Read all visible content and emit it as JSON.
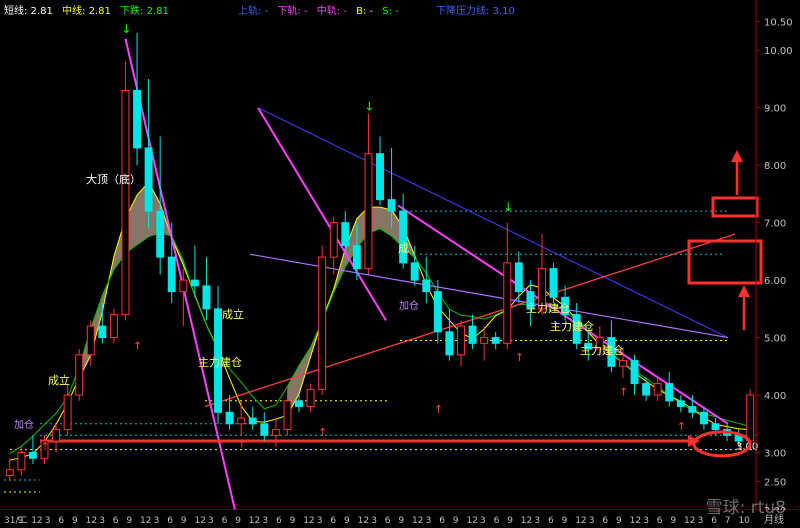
{
  "legend": {
    "short_label": "短线: 2.81",
    "mid_label": "中线: 2.81",
    "down_label": "下跌: 2.81",
    "upper_rail": "上轨: -",
    "down_rail": "下轨: -",
    "mid_rail": "中轨: -",
    "b_label": "B: -",
    "s_label": "S: -",
    "pressure_label": "下降压力线: 3.10"
  },
  "watermark": "雪球: rtu8",
  "period_label": "月线",
  "colors": {
    "up": "#ff3232",
    "down": "#00e5e5",
    "magenta": "#ff40ff",
    "blue": "#4040ff",
    "lavender": "#b070ff",
    "yellow": "#ffff00",
    "green": "#00ff00",
    "red": "#ff3030",
    "grid": "#7a0000",
    "text": "#c0c0c0"
  },
  "chart_data": {
    "type": "candlestick",
    "ylim": [
      2.0,
      10.7
    ],
    "y_ticks": [
      "10.50",
      "10.00",
      "9.00",
      "8.00",
      "7.00",
      "6.00",
      "5.00",
      "4.00",
      "3.00",
      "2.50",
      "2.00"
    ],
    "y_tick_values": [
      10.5,
      10.0,
      9.0,
      8.0,
      7.0,
      6.0,
      5.0,
      4.0,
      3.0,
      2.5,
      2.0
    ],
    "x_labels": [
      "31/二",
      "9",
      "12",
      "3",
      "6",
      "9",
      "12",
      "3",
      "6",
      "9",
      "12",
      "3",
      "6",
      "9",
      "12",
      "3",
      "6",
      "9",
      "12",
      "3",
      "6",
      "9",
      "12",
      "3",
      "6",
      "9",
      "12",
      "3",
      "6",
      "9",
      "12",
      "3",
      "6",
      "9",
      "12",
      "3",
      "6",
      "9",
      "12",
      "3",
      "6",
      "9",
      "12",
      "3",
      "6",
      "9",
      "12",
      "3",
      "6",
      "9",
      "12",
      "3",
      "6",
      "7",
      "10"
    ],
    "candles": [
      [
        2.6,
        2.9,
        2.5,
        2.7
      ],
      [
        2.7,
        3.1,
        2.6,
        3.0
      ],
      [
        3.0,
        3.3,
        2.8,
        2.9
      ],
      [
        2.9,
        3.3,
        2.8,
        3.2
      ],
      [
        3.2,
        3.5,
        3.0,
        3.4
      ],
      [
        3.4,
        4.2,
        3.3,
        4.0
      ],
      [
        4.0,
        4.8,
        3.9,
        4.7
      ],
      [
        4.7,
        5.3,
        4.5,
        5.2
      ],
      [
        5.2,
        5.6,
        4.9,
        5.0
      ],
      [
        5.0,
        5.5,
        4.9,
        5.4
      ],
      [
        5.4,
        9.8,
        5.3,
        9.3
      ],
      [
        9.3,
        10.3,
        8.0,
        8.3
      ],
      [
        8.3,
        9.5,
        6.9,
        7.2
      ],
      [
        7.2,
        8.5,
        6.1,
        6.4
      ],
      [
        6.4,
        7.0,
        5.6,
        5.8
      ],
      [
        5.8,
        6.2,
        5.2,
        6.0
      ],
      [
        6.0,
        6.6,
        5.7,
        5.9
      ],
      [
        5.9,
        6.4,
        5.3,
        5.5
      ],
      [
        5.5,
        5.9,
        3.5,
        3.7
      ],
      [
        3.7,
        4.0,
        3.4,
        3.5
      ],
      [
        3.5,
        3.9,
        3.3,
        3.6
      ],
      [
        3.6,
        3.8,
        3.4,
        3.5
      ],
      [
        3.5,
        3.7,
        3.2,
        3.3
      ],
      [
        3.3,
        3.6,
        3.1,
        3.4
      ],
      [
        3.4,
        4.0,
        3.3,
        3.9
      ],
      [
        3.9,
        4.0,
        3.7,
        3.8
      ],
      [
        3.8,
        4.2,
        3.7,
        4.1
      ],
      [
        4.1,
        6.6,
        4.0,
        6.4
      ],
      [
        6.4,
        7.1,
        6.1,
        7.0
      ],
      [
        7.0,
        7.2,
        6.5,
        6.6
      ],
      [
        6.6,
        7.0,
        6.0,
        6.2
      ],
      [
        6.2,
        8.9,
        6.1,
        8.2
      ],
      [
        8.2,
        8.5,
        7.3,
        7.4
      ],
      [
        7.4,
        8.3,
        6.9,
        7.2
      ],
      [
        7.2,
        7.5,
        6.2,
        6.3
      ],
      [
        6.3,
        6.6,
        5.9,
        6.0
      ],
      [
        6.0,
        6.4,
        5.6,
        5.8
      ],
      [
        5.8,
        6.0,
        4.9,
        5.1
      ],
      [
        5.1,
        5.5,
        4.6,
        4.7
      ],
      [
        4.7,
        5.3,
        4.5,
        5.2
      ],
      [
        5.2,
        5.4,
        4.8,
        4.9
      ],
      [
        4.9,
        5.2,
        4.6,
        5.0
      ],
      [
        5.0,
        5.1,
        4.8,
        4.9
      ],
      [
        4.9,
        7.0,
        4.8,
        6.3
      ],
      [
        6.3,
        6.5,
        5.6,
        5.8
      ],
      [
        5.8,
        6.0,
        5.2,
        5.5
      ],
      [
        5.5,
        6.8,
        5.4,
        6.2
      ],
      [
        6.2,
        6.3,
        5.6,
        5.7
      ],
      [
        5.7,
        5.9,
        5.3,
        5.4
      ],
      [
        5.4,
        5.6,
        4.8,
        4.9
      ],
      [
        4.9,
        5.1,
        4.6,
        4.8
      ],
      [
        4.8,
        5.2,
        4.7,
        5.0
      ],
      [
        5.0,
        5.3,
        4.4,
        4.5
      ],
      [
        4.5,
        4.8,
        4.3,
        4.6
      ],
      [
        4.6,
        4.7,
        4.0,
        4.2
      ],
      [
        4.2,
        4.3,
        3.9,
        4.0
      ],
      [
        4.0,
        4.3,
        3.9,
        4.2
      ],
      [
        4.2,
        4.4,
        3.8,
        3.9
      ],
      [
        3.9,
        4.0,
        3.7,
        3.8
      ],
      [
        3.8,
        4.0,
        3.6,
        3.7
      ],
      [
        3.7,
        3.8,
        3.4,
        3.5
      ],
      [
        3.5,
        3.6,
        3.3,
        3.4
      ],
      [
        3.4,
        3.5,
        3.2,
        3.3
      ],
      [
        3.3,
        3.4,
        3.1,
        3.2
      ],
      [
        3.2,
        4.1,
        3.1,
        4.0
      ]
    ],
    "annotations": [
      "大顶（底）",
      "成立",
      "成立",
      "主力建仓",
      "成",
      "主力建仓",
      "主力建仓",
      "主力建仓",
      "加仓",
      "加仓"
    ],
    "last_price_label": "3.00"
  }
}
